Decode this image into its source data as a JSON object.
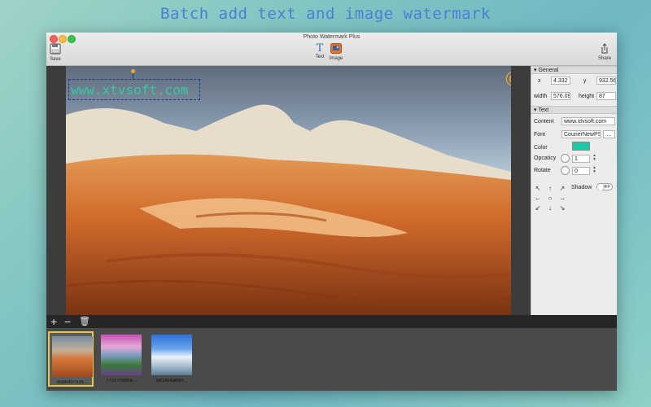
{
  "headline": "Batch add text and image watermark",
  "window": {
    "title": "Photo Watermark Plus"
  },
  "toolbar": {
    "save_label": "Save",
    "text_label": "Text",
    "image_label": "Image",
    "share_label": "Share",
    "text_glyph": "T"
  },
  "canvas": {
    "watermark_text": "www.xtvsoft.com",
    "copyright_symbol": "©"
  },
  "inspector": {
    "general_header": "General",
    "x_label": "x",
    "x_value": "4.332",
    "y_label": "y",
    "y_value": "932.56",
    "width_label": "width",
    "width_value": "576.09",
    "height_label": "height",
    "height_value": "87",
    "text_header": "Text",
    "content_label": "Content",
    "content_value": "www.xtvsoft.com",
    "font_label": "Font",
    "font_value": "CourierNewPS",
    "font_button": "...",
    "color_label": "Color",
    "color_value": "#21c6a4",
    "opacity_label": "Opcaticy",
    "opacity_value": "1",
    "rotate_label": "Rotate",
    "rotate_value": "0",
    "shadow_label": "Shadow",
    "shadow_toggle": "OFF",
    "arrows": [
      "↖",
      "↑",
      "↗",
      "←",
      "○",
      "→",
      "↙",
      "↓",
      "↘"
    ]
  },
  "listbar": {
    "add": "+",
    "remove": "−",
    "trash": "🗑"
  },
  "thumbnails": [
    {
      "caption": "65b6497535...",
      "selected": true
    },
    {
      "caption": "77c570585e...",
      "selected": false
    },
    {
      "caption": "581404a6b0...",
      "selected": false
    }
  ],
  "colors": {
    "accent_watermark": "#38c7a0",
    "copyright": "#f2a52a",
    "selection": "#e5c84a"
  }
}
